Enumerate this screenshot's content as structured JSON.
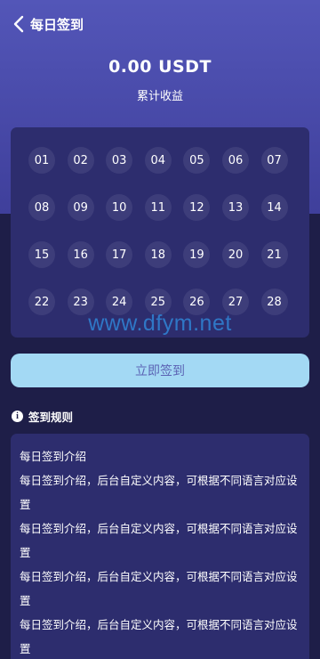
{
  "header": {
    "back_icon": "chevron-left-icon",
    "title": "每日签到"
  },
  "summary": {
    "amount": "0.00 USDT",
    "label": "累计收益"
  },
  "calendar": {
    "days": [
      "01",
      "02",
      "03",
      "04",
      "05",
      "06",
      "07",
      "08",
      "09",
      "10",
      "11",
      "12",
      "13",
      "14",
      "15",
      "16",
      "17",
      "18",
      "19",
      "20",
      "21",
      "22",
      "23",
      "24",
      "25",
      "26",
      "27",
      "28"
    ]
  },
  "watermark": "www.dfym.net",
  "signin_button": {
    "label": "立即签到"
  },
  "rules": {
    "icon": "info-icon",
    "title": "签到规则",
    "lines": [
      "每日签到介绍",
      "每日签到介绍，后台自定义内容，可根据不同语言对应设置",
      "每日签到介绍，后台自定义内容，可根据不同语言对应设置",
      "每日签到介绍，后台自定义内容，可根据不同语言对应设置",
      "每日签到介绍，后台自定义内容，可根据不同语言对应设置"
    ]
  },
  "colors": {
    "header_gradient_top": "#5356b8",
    "page_background": "#1e1e48",
    "card_background": "#2d2d6e",
    "button_background": "#a3d9f4",
    "button_text": "#5b63b4"
  }
}
